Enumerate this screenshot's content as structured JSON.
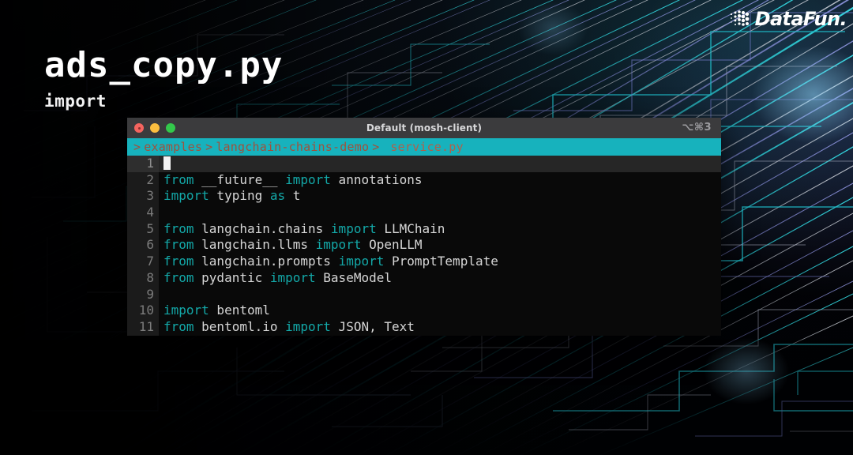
{
  "headline": {
    "title": "ads_copy.py",
    "subtitle": "import"
  },
  "brand": {
    "word": "DataFun.",
    "mark_icon": "dotted-halftone-icon"
  },
  "terminal": {
    "titlebar": {
      "title": "Default (mosh-client)",
      "shortcut": "⌥⌘3",
      "traffic_lights": [
        {
          "name": "close",
          "color": "#f4645f"
        },
        {
          "name": "minimize",
          "color": "#fbbe3f"
        },
        {
          "name": "maximize",
          "color": "#33c84b"
        }
      ]
    },
    "breadcrumb": {
      "background": "#17b2bd",
      "text_color": "#a0513c",
      "lead_separator": ">",
      "segments": [
        "examples",
        "langchain-chains-demo"
      ],
      "separator": ">",
      "file": "service.py"
    },
    "editor": {
      "active_line": 1,
      "keyword_color": "#13a8a8",
      "identifier_color": "#d6d6d6",
      "lines": [
        {
          "n": "1",
          "tokens": [],
          "cursor": true
        },
        {
          "n": "2",
          "tokens": [
            {
              "t": "from",
              "k": "kw"
            },
            {
              "t": " __future__ ",
              "k": "id"
            },
            {
              "t": "import",
              "k": "kw"
            },
            {
              "t": " annotations",
              "k": "id"
            }
          ]
        },
        {
          "n": "3",
          "tokens": [
            {
              "t": "import",
              "k": "kw"
            },
            {
              "t": " typing ",
              "k": "id"
            },
            {
              "t": "as",
              "k": "kw"
            },
            {
              "t": " t",
              "k": "id"
            }
          ]
        },
        {
          "n": "4",
          "tokens": []
        },
        {
          "n": "5",
          "tokens": [
            {
              "t": "from",
              "k": "kw"
            },
            {
              "t": " langchain.chains ",
              "k": "id"
            },
            {
              "t": "import",
              "k": "kw"
            },
            {
              "t": " LLMChain",
              "k": "id"
            }
          ]
        },
        {
          "n": "6",
          "tokens": [
            {
              "t": "from",
              "k": "kw"
            },
            {
              "t": " langchain.llms ",
              "k": "id"
            },
            {
              "t": "import",
              "k": "kw"
            },
            {
              "t": " OpenLLM",
              "k": "id"
            }
          ]
        },
        {
          "n": "7",
          "tokens": [
            {
              "t": "from",
              "k": "kw"
            },
            {
              "t": " langchain.prompts ",
              "k": "id"
            },
            {
              "t": "import",
              "k": "kw"
            },
            {
              "t": " PromptTemplate",
              "k": "id"
            }
          ]
        },
        {
          "n": "8",
          "tokens": [
            {
              "t": "from",
              "k": "kw"
            },
            {
              "t": " pydantic ",
              "k": "id"
            },
            {
              "t": "import",
              "k": "kw"
            },
            {
              "t": " BaseModel",
              "k": "id"
            }
          ]
        },
        {
          "n": "9",
          "tokens": []
        },
        {
          "n": "10",
          "tokens": [
            {
              "t": "import",
              "k": "kw"
            },
            {
              "t": " bentoml",
              "k": "id"
            }
          ]
        },
        {
          "n": "11",
          "tokens": [
            {
              "t": "from",
              "k": "kw"
            },
            {
              "t": " bentoml.io ",
              "k": "id"
            },
            {
              "t": "import",
              "k": "kw"
            },
            {
              "t": " JSON, Text",
              "k": "id"
            }
          ]
        }
      ]
    }
  },
  "colors": {
    "background": "#030408",
    "accent_teal": "#17b2bd",
    "accent_purple": "#6b6fbe",
    "titlebar": "#3b3b3d",
    "code_background": "#090909",
    "gutter": "#1b1b1b"
  }
}
